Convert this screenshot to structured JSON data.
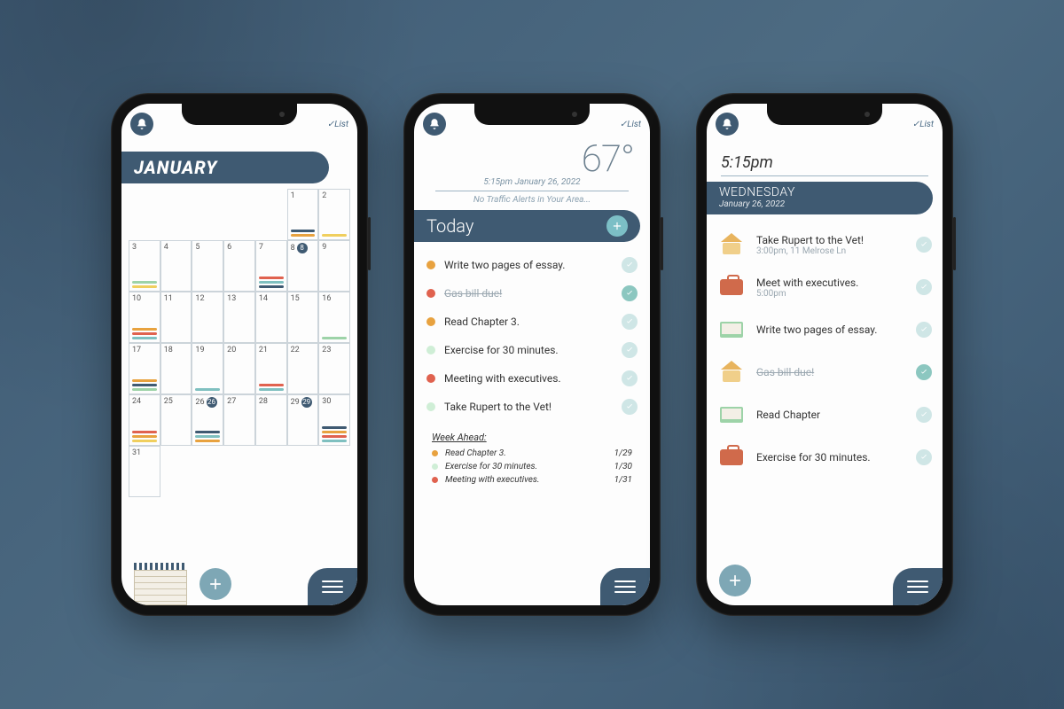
{
  "brand": "✓List",
  "phone1": {
    "month": "JANUARY",
    "days": [
      "1",
      "2",
      "3",
      "4",
      "5",
      "6",
      "7",
      "8",
      "9",
      "10",
      "11",
      "12",
      "13",
      "14",
      "15",
      "16",
      "17",
      "18",
      "19",
      "20",
      "21",
      "22",
      "23",
      "24",
      "25",
      "26",
      "27",
      "28",
      "29",
      "30",
      "31"
    ]
  },
  "phone2": {
    "temperature": "67°",
    "datetime": "5:15pm January 26, 2022",
    "traffic": "No Traffic Alerts in Your Area...",
    "today_label": "Today",
    "tasks": [
      {
        "color": "#e8a23f",
        "label": "Write two pages of essay.",
        "done": false
      },
      {
        "color": "#e0624f",
        "label": "Gas bill due!",
        "done": true
      },
      {
        "color": "#e8a23f",
        "label": "Read Chapter 3.",
        "done": false
      },
      {
        "color": "#cfeed6",
        "label": "Exercise for 30 minutes.",
        "done": false
      },
      {
        "color": "#e0624f",
        "label": "Meeting with executives.",
        "done": false
      },
      {
        "color": "#cfeed6",
        "label": "Take Rupert to the Vet!",
        "done": false
      }
    ],
    "week_label": "Week Ahead:",
    "week": [
      {
        "color": "#e8a23f",
        "label": "Read Chapter 3.",
        "date": "1/29"
      },
      {
        "color": "#cfeed6",
        "label": "Exercise for 30 minutes.",
        "date": "1/30"
      },
      {
        "color": "#e0624f",
        "label": "Meeting with executives.",
        "date": "1/31"
      }
    ]
  },
  "phone3": {
    "time": "5:15pm",
    "day": "WEDNESDAY",
    "date": "January 26, 2022",
    "events": [
      {
        "icon": "house",
        "title": "Take Rupert to the Vet!",
        "sub": "3:00pm, 11 Melrose Ln",
        "done": false
      },
      {
        "icon": "brief",
        "title": "Meet with executives.",
        "sub": "5:00pm",
        "done": false
      },
      {
        "icon": "book",
        "title": "Write two pages of essay.",
        "sub": "",
        "done": false
      },
      {
        "icon": "house",
        "title": "Gas bill due!",
        "sub": "",
        "done": true
      },
      {
        "icon": "book",
        "title": "Read Chapter",
        "sub": "",
        "done": false
      },
      {
        "icon": "brief",
        "title": "Exercise for 30 minutes.",
        "sub": "",
        "done": false
      }
    ]
  }
}
